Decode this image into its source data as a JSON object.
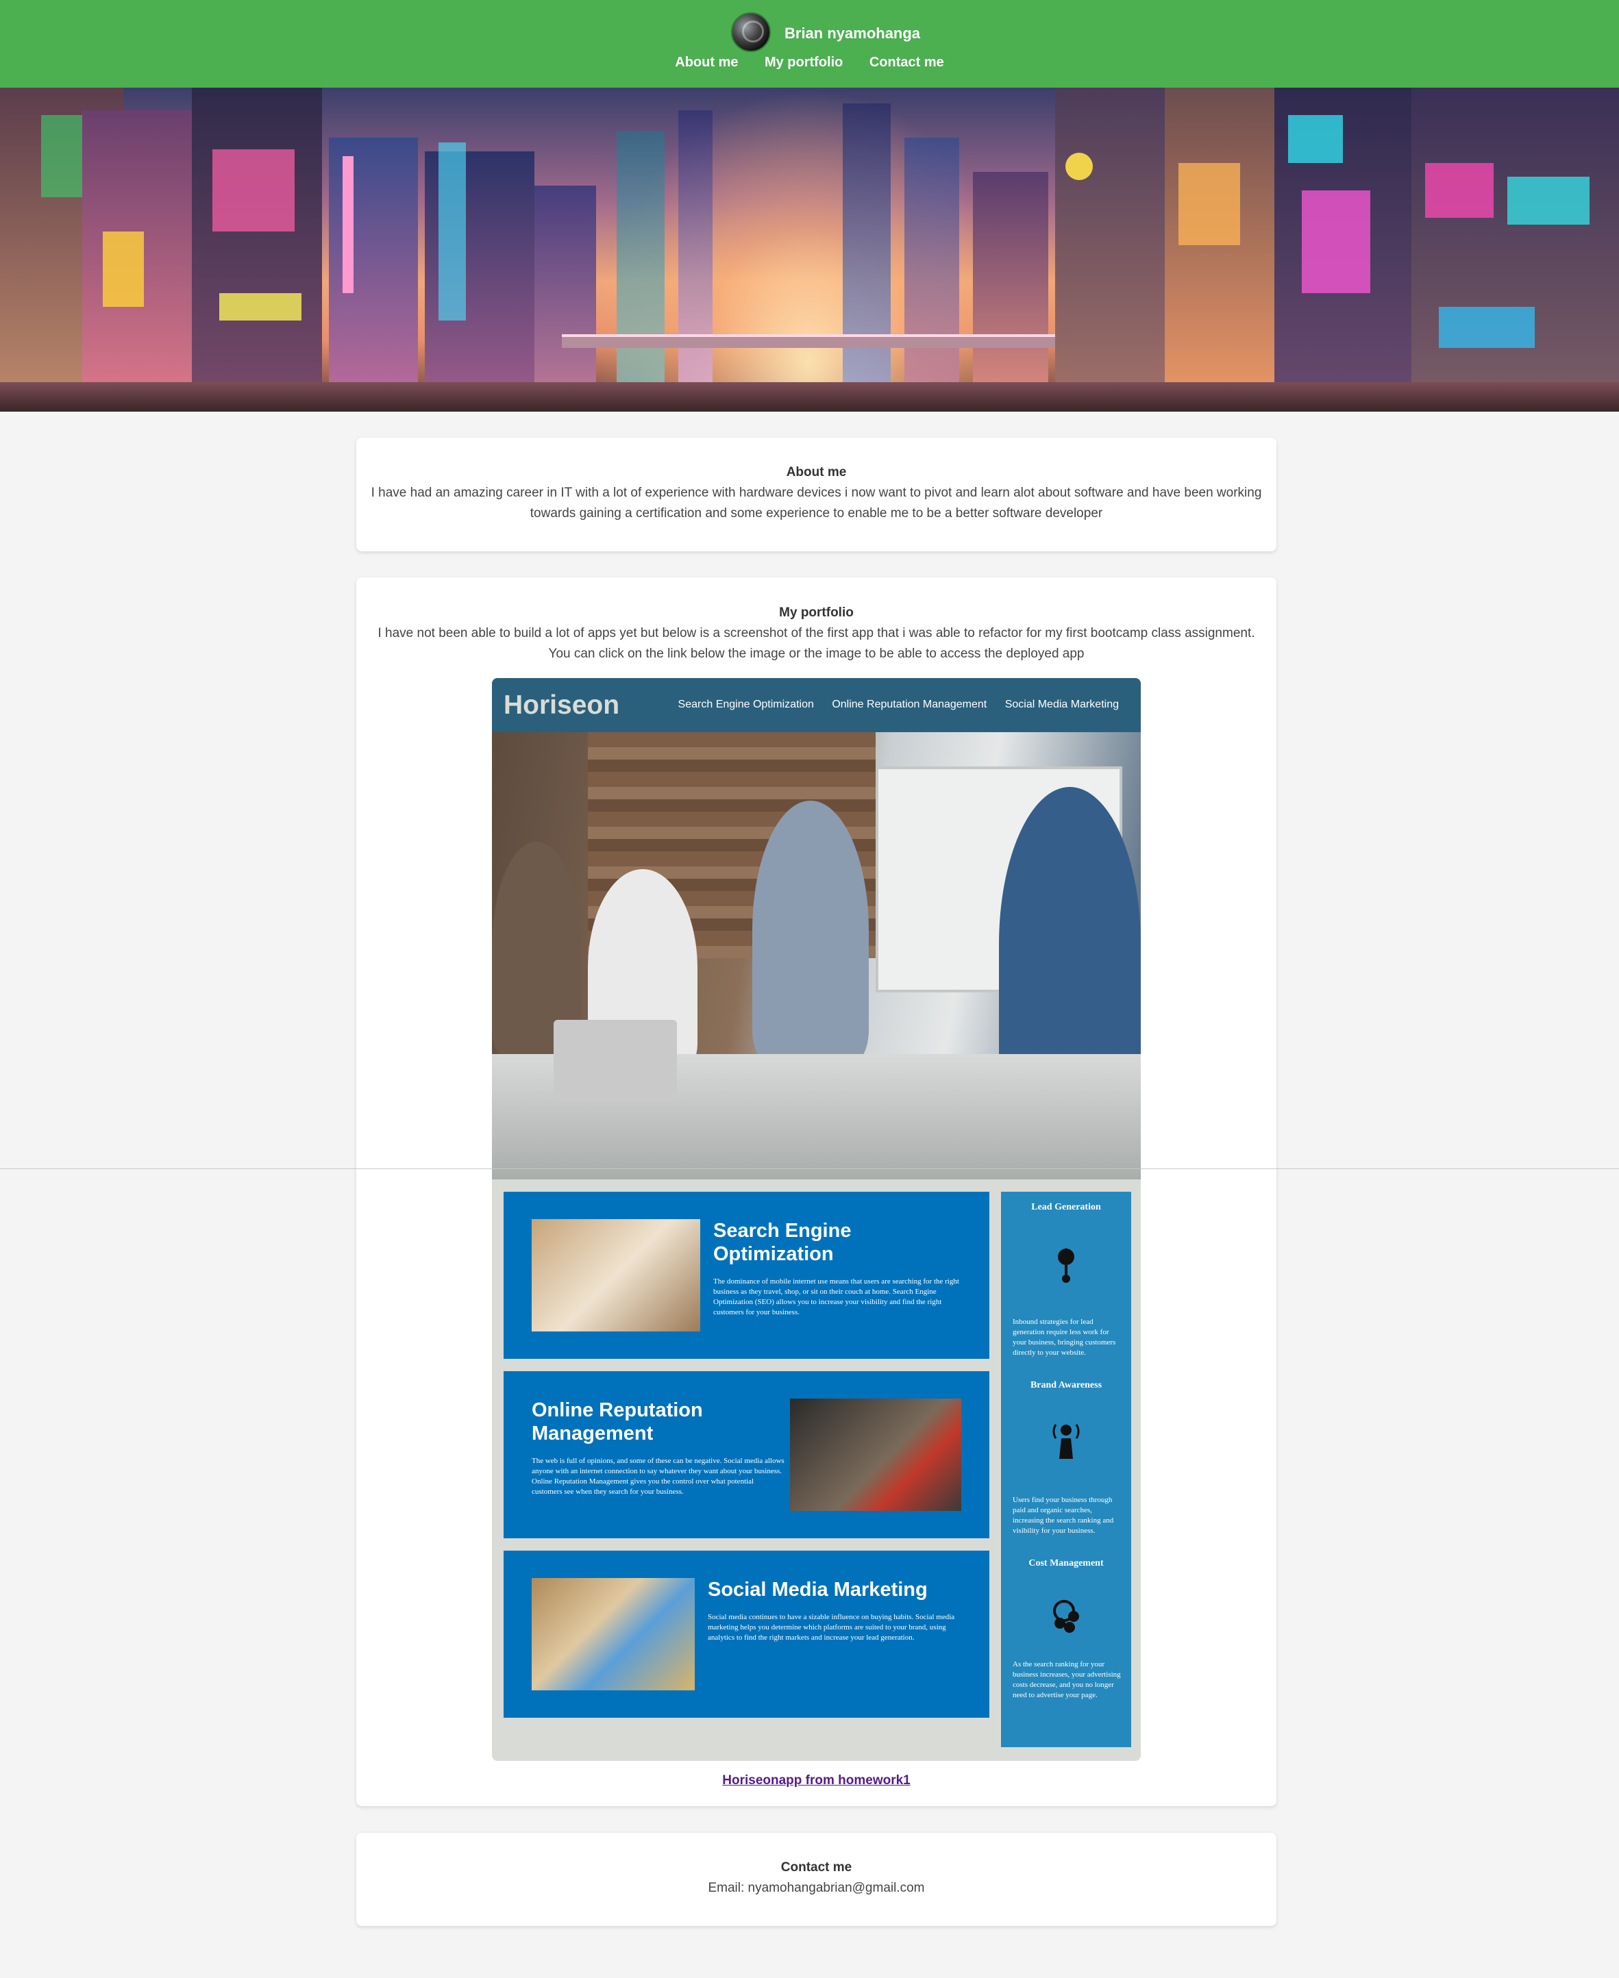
{
  "header": {
    "name": "Brian nyamohanga",
    "nav": [
      "About me",
      "My portfolio",
      "Contact me"
    ]
  },
  "about": {
    "title": "About me",
    "text": "I have had an amazing career in IT with a lot of experience with hardware devices i now want to pivot and learn alot about software and have been working towards gaining a certification and some experience to enable me to be a better software developer"
  },
  "portfolio": {
    "title": "My portfolio",
    "text": "I have not been able to build a lot of apps yet but below is a screenshot of the first app that i was able to refactor for my first bootcamp class assignment. You can click on the link below the image or the image to be able to access the deployed app",
    "link_text": "Horiseonapp from homework1",
    "screenshot": {
      "logo": "Horiseon",
      "nav": [
        "Search Engine Optimization",
        "Online Reputation Management",
        "Social Media Marketing"
      ],
      "sections": [
        {
          "title": "Search Engine Optimization",
          "text": "The dominance of mobile internet use means that users are searching for the right business as they travel, shop, or sit on their couch at home. Search Engine Optimization (SEO) allows you to increase your visibility and find the right customers for your business."
        },
        {
          "title": "Online Reputation Management",
          "text": "The web is full of opinions, and some of these can be negative. Social media allows anyone with an internet connection to say whatever they want about your business. Online Reputation Management gives you the control over what potential customers see when they search for your business."
        },
        {
          "title": "Social Media Marketing",
          "text": "Social media continues to have a sizable influence on buying habits. Social media marketing helps you determine which platforms are suited to your brand, using analytics to find the right markets and increase your lead generation."
        }
      ],
      "benefits": [
        {
          "title": "Lead Generation",
          "text": "Inbound strategies for lead generation require less work for your business, bringing customers directly to your website."
        },
        {
          "title": "Brand Awareness",
          "text": "Users find your business through paid and organic searches, increasing the search ranking and visibility for your business."
        },
        {
          "title": "Cost Management",
          "text": "As the search ranking for your business increases, your advertising costs decrease, and you no longer need to advertise your page."
        }
      ]
    }
  },
  "contact": {
    "title": "Contact me",
    "email": "Email: nyamohangabrian@gmail.com"
  }
}
